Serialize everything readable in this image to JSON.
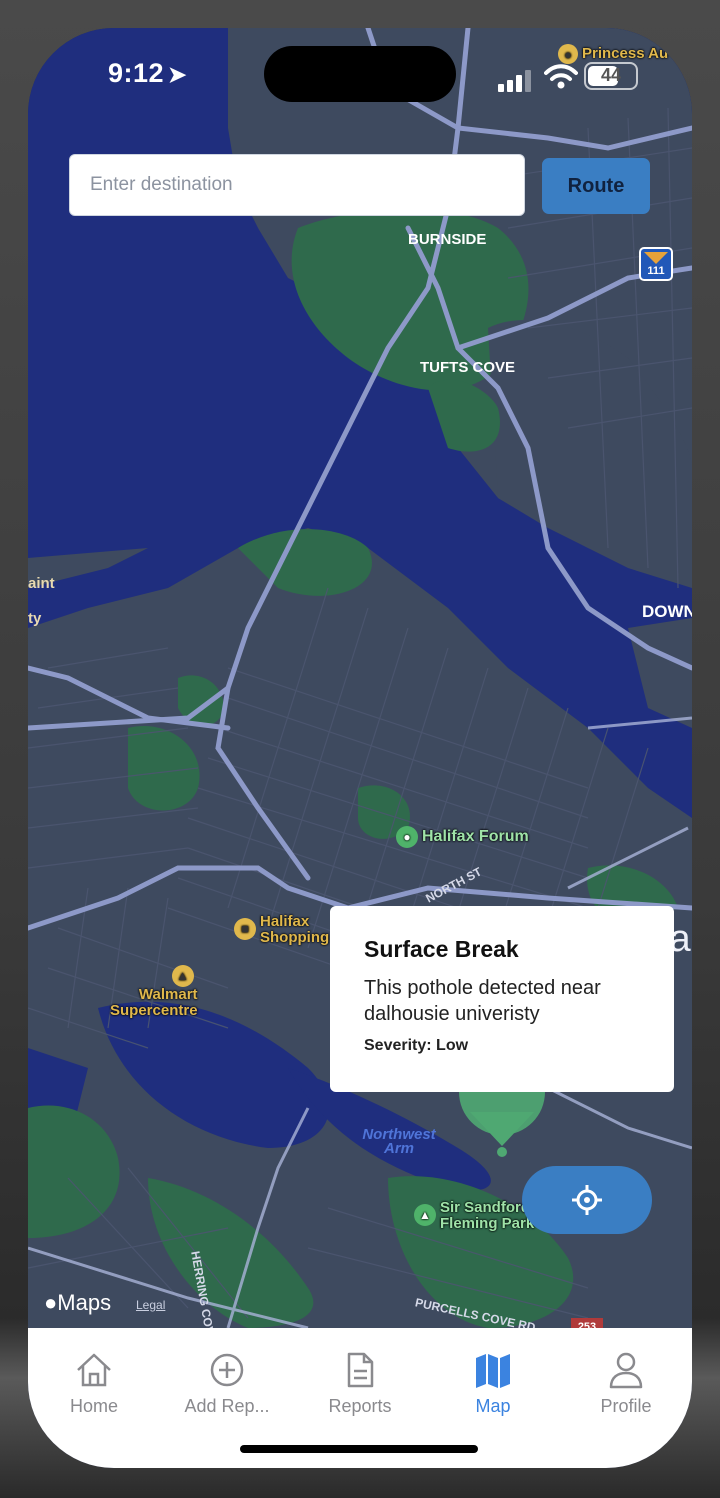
{
  "status_bar": {
    "time": "9:12",
    "battery": "44"
  },
  "search": {
    "placeholder": "Enter destination",
    "route_label": "Route"
  },
  "map": {
    "labels": {
      "burnside": "BURNSIDE",
      "tufts_cove": "TUFTS COVE",
      "downtown_partial": "DOWN",
      "north_st": "NORTH ST",
      "herring_cove_rd": "HERRING COVE RD",
      "purcells_cove_rd": "PURCELLS COVE RD",
      "highway_111": "111",
      "route_253": "253",
      "left_partial_1": "aint",
      "left_partial_2": "ty",
      "right_partial_ha": "Ha",
      "princess_partial": "Princess Au"
    },
    "pois": {
      "halifax_forum": "Halifax Forum",
      "halifax_shopping_centre_1": "Halifax",
      "halifax_shopping_centre_2": "Shopping Centre",
      "walmart_1": "Walmart",
      "walmart_2": "Supercentre",
      "sir_sandford_1": "Sir Sandford",
      "sir_sandford_2": "Fleming Park"
    },
    "water": {
      "northwest_arm_1": "Northwest",
      "northwest_arm_2": "Arm"
    },
    "attribution": {
      "brand": "Maps",
      "legal": "Legal"
    }
  },
  "callout": {
    "title": "Surface Break",
    "description": "This pothole detected near dalhousie univeristy",
    "severity": "Severity: Low"
  },
  "tabs": [
    {
      "label": "Home",
      "icon": "house-icon"
    },
    {
      "label": "Add Rep...",
      "icon": "plus-circle-icon"
    },
    {
      "label": "Reports",
      "icon": "document-icon"
    },
    {
      "label": "Map",
      "icon": "map-icon",
      "active": true
    },
    {
      "label": "Profile",
      "icon": "person-icon"
    }
  ],
  "colors": {
    "accent": "#3b83e0",
    "button": "#3a7ec3",
    "water": "#1e2d7a",
    "land": "#3a4256",
    "park": "#2e6a4a",
    "pin": "#4fa872"
  }
}
